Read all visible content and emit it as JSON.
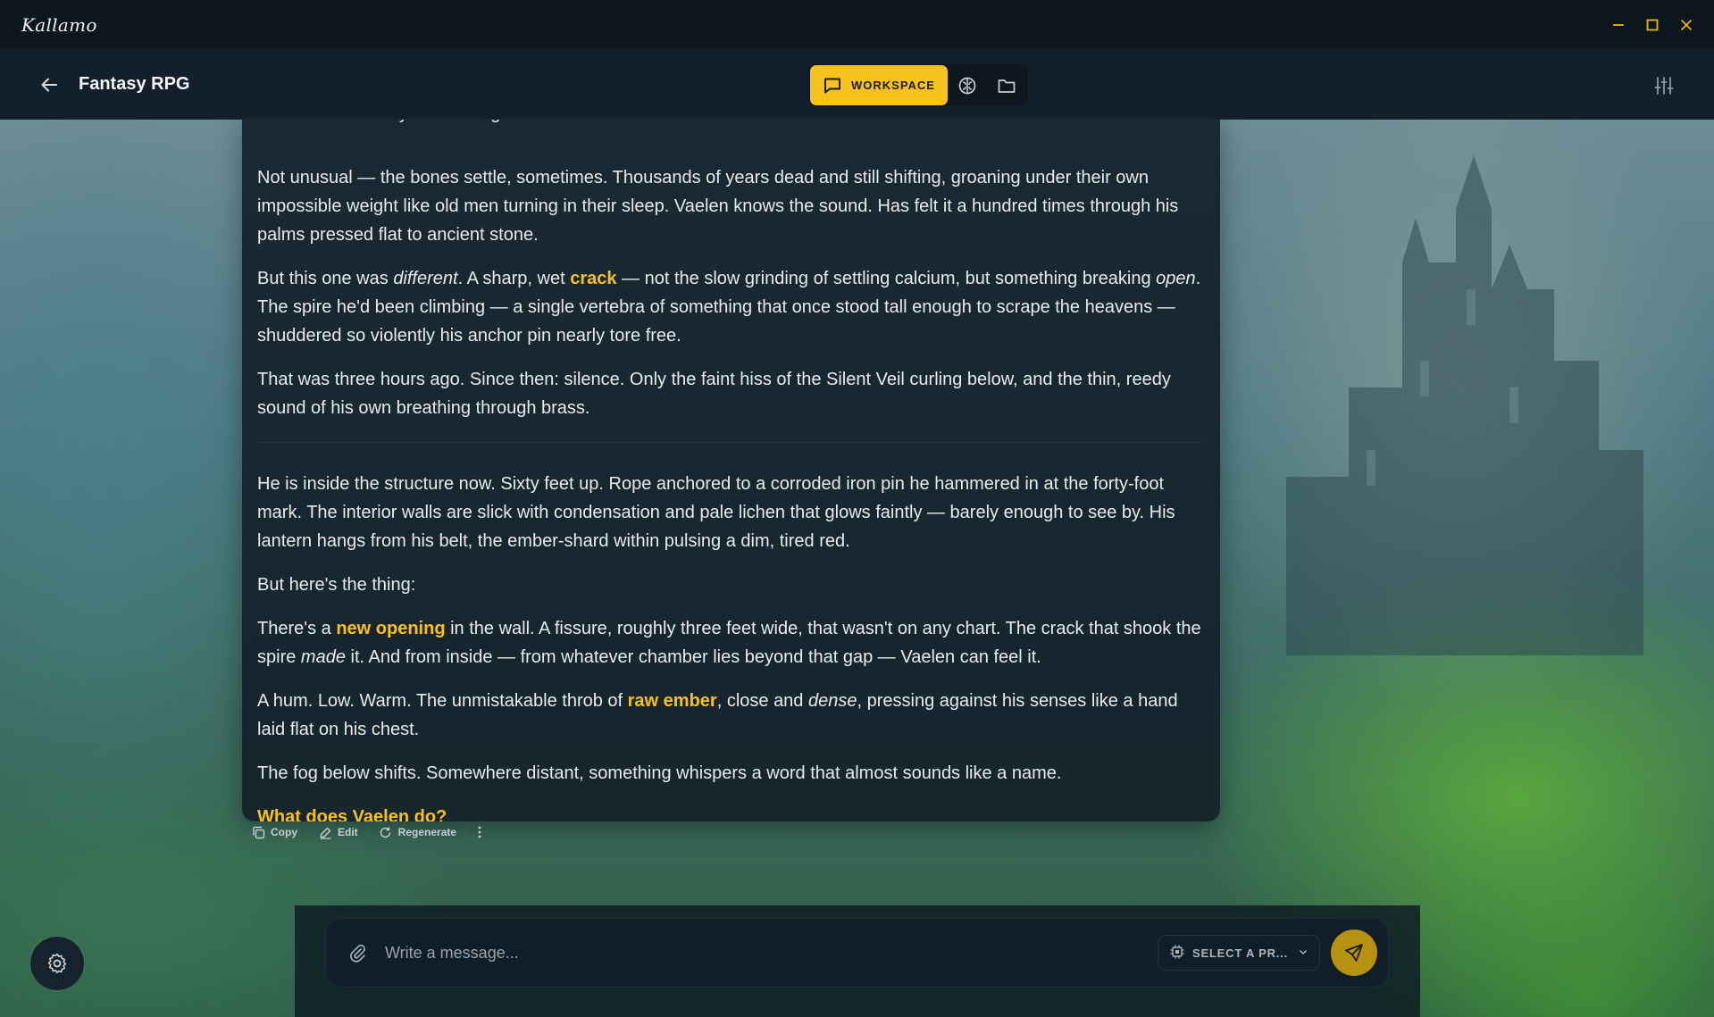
{
  "app": {
    "name": "Kallamo"
  },
  "window_controls": {
    "minimize_icon": "minimize-icon",
    "maximize_icon": "maximize-icon",
    "close_icon": "close-icon"
  },
  "header": {
    "title": "Fantasy RPG",
    "mode_label": "WORKSPACE"
  },
  "message": {
    "cutoff_line": "The tremor hit forty minutes ago.",
    "p1": "Not unusual — the bones settle, sometimes. Thousands of years dead and still shifting, groaning under their own impossible weight like old men turning in their sleep. Vaelen knows the sound. Has felt it a hundred times through his palms pressed flat to ancient stone.",
    "p2": {
      "a": "But this one was ",
      "b_em": "different",
      "c": ". A sharp, wet ",
      "d_hl": "crack",
      "e": " — not the slow grinding of settling calcium, but something breaking ",
      "f_em": "open",
      "g": ". The spire he'd been climbing — a single vertebra of something that once stood tall enough to scrape the heavens — shuddered so violently his anchor pin nearly tore free."
    },
    "p3": "That was three hours ago. Since then: silence. Only the faint hiss of the Silent Veil curling below, and the thin, reedy sound of his own breathing through brass.",
    "p4": "He is inside the structure now. Sixty feet up. Rope anchored to a corroded iron pin he hammered in at the forty-foot mark. The interior walls are slick with condensation and pale lichen that glows faintly — barely enough to see by. His lantern hangs from his belt, the ember-shard within pulsing a dim, tired red.",
    "p5": "But here's the thing:",
    "p6": {
      "a": "There's a ",
      "b_hl": "new opening",
      "c": " in the wall. A fissure, roughly three feet wide, that wasn't on any chart. The crack that shook the spire ",
      "d_em": "made",
      "e": " it. And from inside — from whatever chamber lies beyond that gap — Vaelen can feel it."
    },
    "p7": {
      "a": "A hum. Low. Warm. The unmistakable throb of ",
      "b_hl": "raw ember",
      "c": ", close and ",
      "d_em": "dense",
      "e": ", pressing against his senses like a hand laid flat on his chest."
    },
    "p8": "The fog below shifts. Somewhere distant, something whispers a word that almost sounds like a name.",
    "question": "What does Vaelen do?"
  },
  "actions": {
    "copy": "Copy",
    "edit": "Edit",
    "regenerate": "Regenerate"
  },
  "composer": {
    "placeholder": "Write a message...",
    "preset_label": "SELECT A PR..."
  },
  "colors": {
    "accent": "#f7c21d",
    "send_button": "#b6920f",
    "card": "#14202a"
  }
}
